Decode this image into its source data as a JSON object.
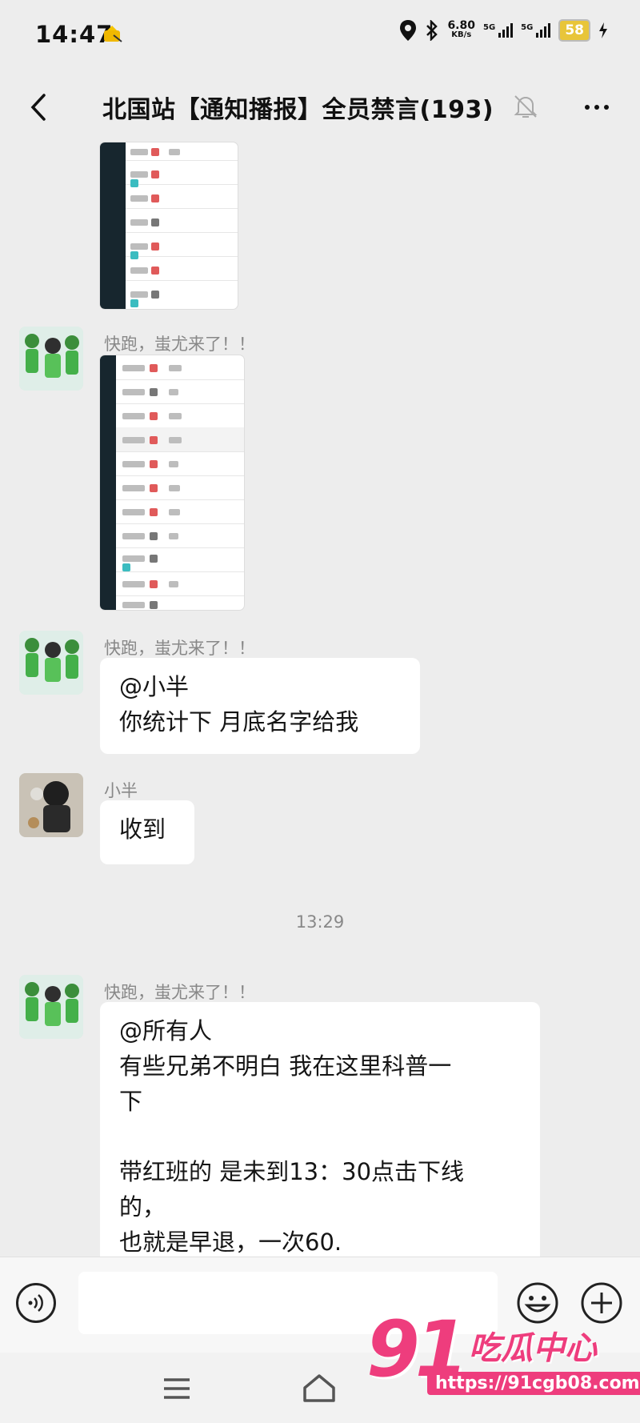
{
  "status_bar": {
    "time": "14:47",
    "net_speed_value": "6.80",
    "net_speed_unit": "KB/s",
    "sim1_label": "5G",
    "sim2_label": "5G",
    "battery": "58",
    "icons": [
      "notification-icon",
      "location-icon",
      "bluetooth-icon",
      "signal-icon",
      "battery-icon",
      "charging-icon"
    ]
  },
  "header": {
    "title": "北国站【通知播报】全员禁言(193)",
    "muted": true
  },
  "messages": [
    {
      "type": "image",
      "sender": "",
      "content": "screenshot"
    },
    {
      "type": "image",
      "sender": "快跑，蚩尤来了！！",
      "content": "screenshot"
    },
    {
      "type": "text",
      "sender": "快跑，蚩尤来了！！",
      "lines": [
        "@小半",
        "你统计下 月底名字给我"
      ]
    },
    {
      "type": "text",
      "sender": "小半",
      "lines": [
        "收到"
      ]
    },
    {
      "type": "timestamp",
      "text": "13:29"
    },
    {
      "type": "text",
      "sender": "快跑，蚩尤来了！！",
      "lines": [
        "@所有人",
        "有些兄弟不明白 我在这里科普一",
        "下",
        "",
        "带红班的 是未到13：30点击下线",
        "的，",
        "也就是早退，一次60."
      ]
    }
  ],
  "input": {
    "placeholder": "",
    "value": ""
  },
  "watermark": {
    "logo": "91",
    "text": "吃瓜中心",
    "url": "https://91cgb08.com"
  },
  "colors": {
    "background": "#ededed",
    "bubble": "#ffffff",
    "watermark": "#ee3d7d",
    "battery": "#e8c53a"
  }
}
